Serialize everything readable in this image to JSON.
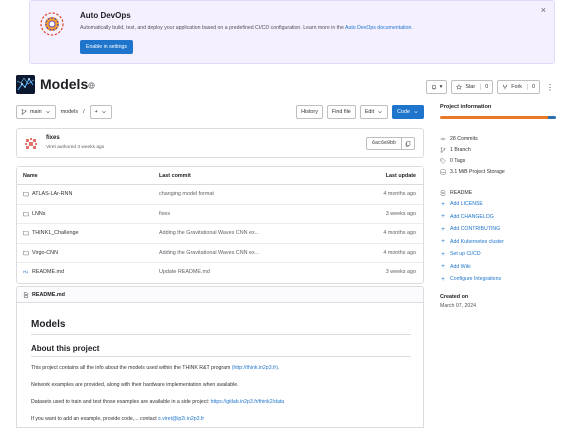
{
  "banner": {
    "title": "Auto DevOps",
    "description": "Automatically build, test, and deploy your application based on a predefined CI/CD configuration. Learn more in the ",
    "doc_link": "Auto DevOps documentation.",
    "button": "Enable in settings",
    "close": "×"
  },
  "project": {
    "title": "Models",
    "notifications": "▾",
    "star": "Star",
    "star_count": "0",
    "fork": "Fork",
    "fork_count": "0",
    "more": "⋮"
  },
  "nav": {
    "branch": "main",
    "path": "models",
    "sep": "/",
    "add": "+",
    "history": "History",
    "find_file": "Find file",
    "edit": "Edit",
    "code": "Code"
  },
  "last_commit": {
    "message": "fixes",
    "author": "Viret",
    "authored_text": "authored 3 weeks ago",
    "sha": "6ac6e9bb"
  },
  "table": {
    "headers": {
      "name": "Name",
      "last_commit": "Last commit",
      "last_update": "Last update"
    },
    "rows": [
      {
        "name": "ATLAS-LAr-RNN",
        "commit": "changing model format",
        "date": "4 months ago",
        "kind": "folder"
      },
      {
        "name": "LNNs",
        "commit": "fixes",
        "date": "3 weeks ago",
        "kind": "folder"
      },
      {
        "name": "THINK1_Challenge",
        "commit": "Adding the Gravitational Waves CNN ex...",
        "date": "4 months ago",
        "kind": "folder"
      },
      {
        "name": "Virgo-CNN",
        "commit": "Adding the Gravitational Waves CNN ex...",
        "date": "4 months ago",
        "kind": "folder"
      },
      {
        "name": "README.md",
        "commit": "Update README.md",
        "date": "3 weeks ago",
        "kind": "markdown"
      }
    ]
  },
  "readme": {
    "filename": "README.md",
    "h1": "Models",
    "h2": "About this project",
    "p1_text": "This project contains all the info about the models used within the THINK R&T program ",
    "p1_link": "(http://think.in2p3.fr)",
    "p1_end": ".",
    "p2": "Network examples are provided, along with their hardware implementation when available.",
    "p3_text": "Datasets used to train and test those examples are available in a side project: ",
    "p3_link": "https://gitlab.in2p3.fr/think2/data",
    "p4_text": "If you want to add an example, provide code,... contact ",
    "p4_link": "s.viret@ip2i.in2p3.fr"
  },
  "sidebar": {
    "title": "Project information",
    "language_colors": [
      "#e87a27",
      "#2f6fb0"
    ],
    "language_shares": [
      0.93,
      0.07
    ],
    "stats": [
      {
        "label": "28 Commits",
        "icon": "commit-icon"
      },
      {
        "label": "1 Branch",
        "icon": "branch-icon"
      },
      {
        "label": "0 Tags",
        "icon": "tag-icon"
      },
      {
        "label": "3.1 MiB Project Storage",
        "icon": "storage-icon"
      }
    ],
    "readme": "README",
    "actions": [
      "Add LICENSE",
      "Add CHANGELOG",
      "Add CONTRIBUTING",
      "Add Kubernetes cluster",
      "Set up CI/CD",
      "Add Wiki",
      "Configure Integrations"
    ],
    "created_label": "Created on",
    "created_date": "March 07, 2024"
  },
  "colors": {
    "accent": "#1f75cb",
    "banner_bg": "#f4f0ff"
  }
}
